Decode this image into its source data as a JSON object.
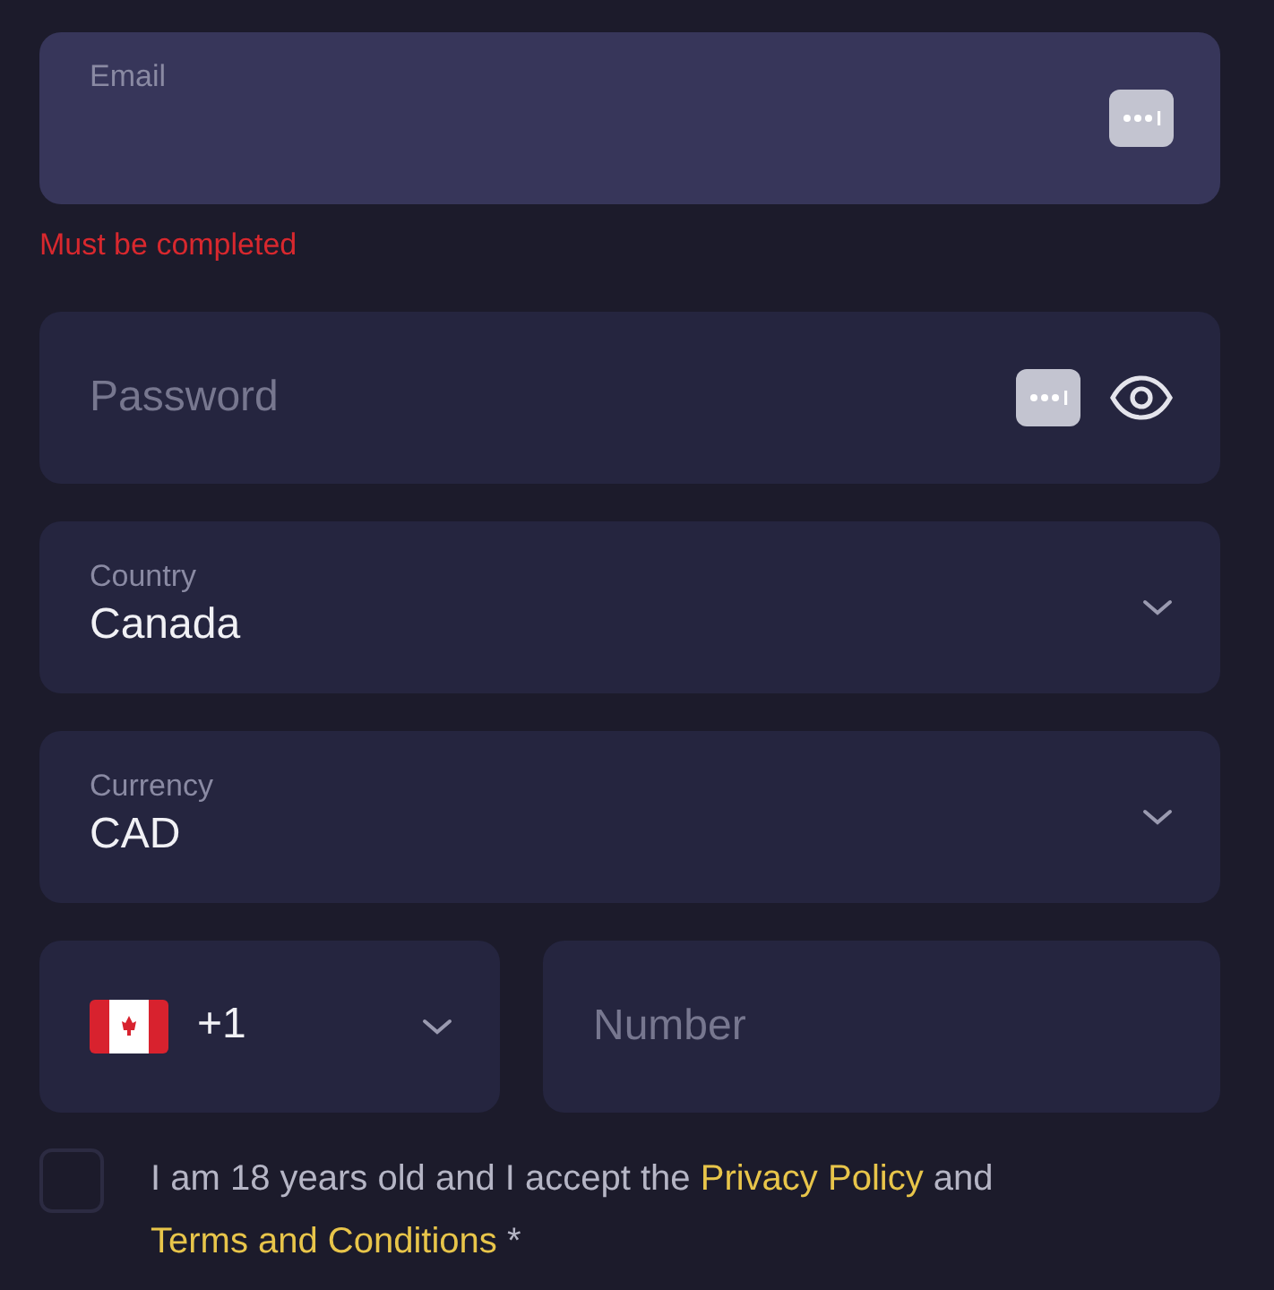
{
  "email": {
    "label": "Email",
    "focused": true,
    "error": "Must be completed"
  },
  "password": {
    "placeholder": "Password"
  },
  "selects": [
    {
      "label": "Country",
      "value": "Canada"
    },
    {
      "label": "Currency",
      "value": "CAD"
    }
  ],
  "phone": {
    "code": "+1",
    "placeholder": "Number"
  },
  "consent": {
    "checked": false,
    "parts": [
      {
        "kind": "text",
        "text": "I am 18 years old and I accept the "
      },
      {
        "kind": "link",
        "text": "Privacy Policy"
      },
      {
        "kind": "text",
        "text": " and "
      },
      {
        "kind": "link",
        "text": "Terms and Conditions"
      },
      {
        "kind": "text",
        "text": " *"
      }
    ]
  }
}
